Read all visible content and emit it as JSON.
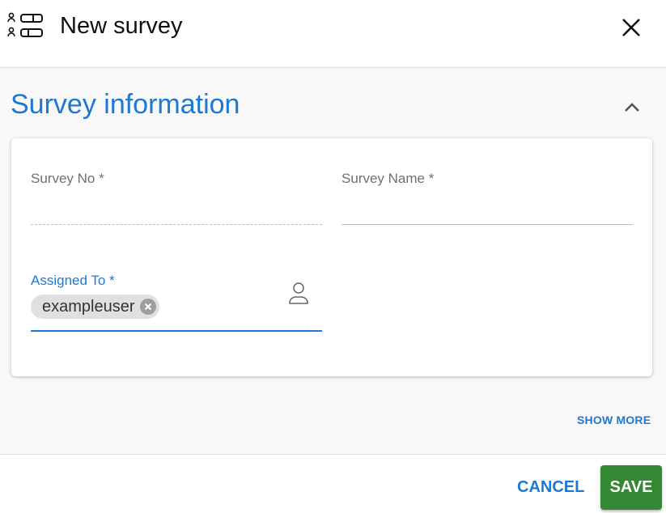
{
  "header": {
    "icon": "survey-list-icon",
    "title": "New survey",
    "close_icon": "close-icon"
  },
  "section": {
    "title": "Survey information",
    "collapse_icon": "chevron-up-icon"
  },
  "form": {
    "survey_no": {
      "label": "Survey No *",
      "value": ""
    },
    "survey_name": {
      "label": "Survey Name *",
      "value": ""
    },
    "assigned_to": {
      "label": "Assigned To *",
      "chips": [
        "exampleuser"
      ],
      "picker_icon": "person-icon"
    }
  },
  "show_more_label": "SHOW MORE",
  "footer": {
    "cancel_label": "CANCEL",
    "save_label": "SAVE"
  },
  "colors": {
    "accent": "#1e78d2",
    "save": "#348834"
  }
}
